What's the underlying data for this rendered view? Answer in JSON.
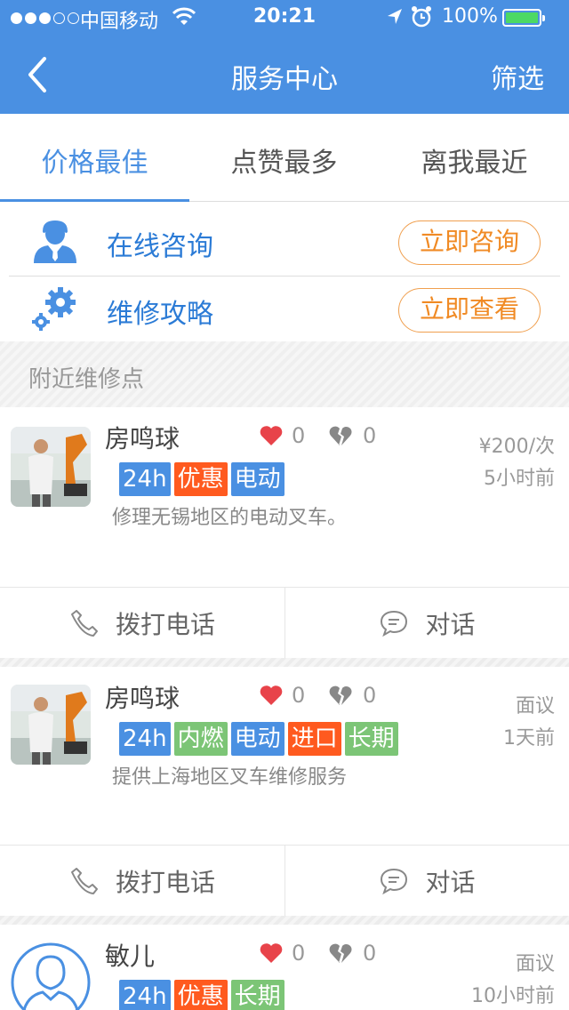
{
  "status_bar": {
    "signal_dots_filled": 3,
    "signal_dots_total": 5,
    "carrier": "中国移动",
    "time": "20:21",
    "battery_text": "100%",
    "battery_level": 1.0,
    "battery_color": "#4cd964"
  },
  "nav": {
    "title": "服务中心",
    "filter_label": "筛选",
    "background": "#4a90e2"
  },
  "tabs": [
    {
      "label": "价格最佳",
      "active": true
    },
    {
      "label": "点赞最多",
      "active": false
    },
    {
      "label": "离我最近",
      "active": false
    }
  ],
  "quick_actions": [
    {
      "icon": "person-icon",
      "label": "在线咨询",
      "button": "立即咨询"
    },
    {
      "icon": "gears-icon",
      "label": "维修攻略",
      "button": "立即查看"
    }
  ],
  "section": {
    "title": "附近维修点"
  },
  "providers": [
    {
      "name": "房鸣球",
      "likes": "0",
      "dislikes": "0",
      "price": "¥200/次",
      "time_ago": "5小时前",
      "tags": [
        {
          "text": "24h",
          "color": "#4a90e2"
        },
        {
          "text": "优惠",
          "color": "#ff5a1f"
        },
        {
          "text": "电动",
          "color": "#4a90e2"
        }
      ],
      "description": "修理无锡地区的电动叉车。",
      "call_label": "拨打电话",
      "chat_label": "对话"
    },
    {
      "name": "房鸣球",
      "likes": "0",
      "dislikes": "0",
      "price": "面议",
      "time_ago": "1天前",
      "tags": [
        {
          "text": "24h",
          "color": "#4a90e2"
        },
        {
          "text": "内燃",
          "color": "#7cc576"
        },
        {
          "text": "电动",
          "color": "#4a90e2"
        },
        {
          "text": "进口",
          "color": "#ff5a1f"
        },
        {
          "text": "长期",
          "color": "#7cc576"
        }
      ],
      "description": "提供上海地区叉车维修服务",
      "call_label": "拨打电话",
      "chat_label": "对话"
    },
    {
      "name": "敏儿",
      "likes": "0",
      "dislikes": "0",
      "price": "面议",
      "time_ago": "10小时前",
      "tags": [
        {
          "text": "24h",
          "color": "#4a90e2"
        },
        {
          "text": "优惠",
          "color": "#ff5a1f"
        },
        {
          "text": "长期",
          "color": "#7cc576"
        }
      ],
      "description": "",
      "call_label": "",
      "chat_label": ""
    }
  ]
}
